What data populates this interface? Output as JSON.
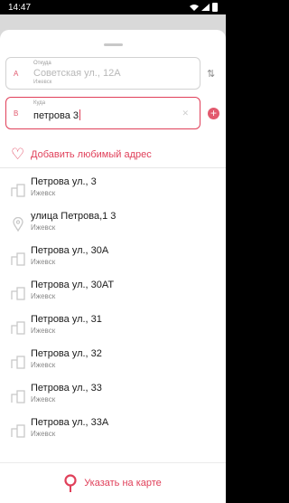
{
  "status_bar": {
    "time": "14:47"
  },
  "route": {
    "from": {
      "letter": "A",
      "label": "Откуда",
      "value": "Советская ул., 12А",
      "city": "Ижевск"
    },
    "to": {
      "letter": "B",
      "label": "Куда",
      "value": "петрова 3"
    }
  },
  "favorite": {
    "label": "Добавить любимый адрес"
  },
  "suggestions": [
    {
      "icon": "building-icon",
      "title": "Петрова ул., 3",
      "city": "Ижевск"
    },
    {
      "icon": "location-pin-icon",
      "title": "улица Петрова,1 3",
      "city": "Ижевск"
    },
    {
      "icon": "building-icon",
      "title": "Петрова ул., 30А",
      "city": "Ижевск"
    },
    {
      "icon": "building-icon",
      "title": "Петрова ул., 30АТ",
      "city": "Ижевск"
    },
    {
      "icon": "building-icon",
      "title": "Петрова ул., 31",
      "city": "Ижевск"
    },
    {
      "icon": "building-icon",
      "title": "Петрова ул., 32",
      "city": "Ижевск"
    },
    {
      "icon": "building-icon",
      "title": "Петрова ул., 33",
      "city": "Ижевск"
    },
    {
      "icon": "building-icon",
      "title": "Петрова ул., 33А",
      "city": "Ижевск"
    }
  ],
  "bottom_action": {
    "label": "Указать на карте"
  },
  "colors": {
    "accent": "#e0405a",
    "muted": "#8a8a8a"
  }
}
